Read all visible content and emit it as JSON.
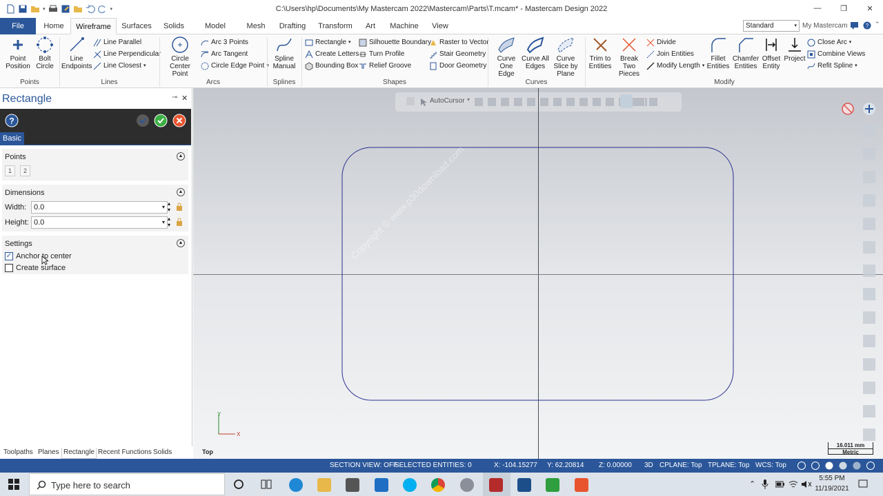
{
  "window": {
    "title": "C:\\Users\\hp\\Documents\\My Mastercam 2022\\Mastercam\\Parts\\T.mcam* - Mastercam Design 2022",
    "controls": [
      "minimize-icon",
      "restore-icon",
      "close-icon"
    ]
  },
  "ribbon": {
    "tabs": [
      "File",
      "Home",
      "Wireframe",
      "Surfaces",
      "Solids",
      "Model Prep",
      "Mesh",
      "Drafting",
      "Transform",
      "Art",
      "Machine",
      "View"
    ],
    "active_tab": "Wireframe",
    "config_select": "Standard",
    "my_mastercam": "My Mastercam",
    "groups": {
      "points": {
        "label": "Points",
        "point_position": "Point Position",
        "bolt_circle": "Bolt Circle"
      },
      "lines": {
        "label": "Lines",
        "line_endpoints": "Line Endpoints",
        "line_parallel": "Line Parallel",
        "line_perpendicular": "Line Perpendicular",
        "line_closest": "Line Closest"
      },
      "arcs": {
        "label": "Arcs",
        "circle_center_point": "Circle Center Point",
        "arc_3_points": "Arc 3 Points",
        "arc_tangent": "Arc Tangent",
        "circle_edge_point": "Circle Edge Point"
      },
      "splines": {
        "label": "Splines",
        "spline_manual": "Spline Manual"
      },
      "shapes": {
        "label": "Shapes",
        "rectangle": "Rectangle",
        "create_letters": "Create Letters",
        "bounding_box": "Bounding Box",
        "silhouette_boundary": "Silhouette Boundary",
        "turn_profile": "Turn Profile",
        "relief_groove": "Relief Groove",
        "raster_to_vector": "Raster to Vector",
        "stair_geometry": "Stair Geometry",
        "door_geometry": "Door Geometry"
      },
      "curves": {
        "label": "Curves",
        "curve_one_edge": "Curve One Edge",
        "curve_all_edges": "Curve All Edges",
        "curve_slice_by_plane": "Curve Slice by Plane"
      },
      "modify": {
        "label": "Modify",
        "trim_to_entities": "Trim to Entities",
        "break_two_pieces": "Break Two Pieces",
        "divide": "Divide",
        "join_entities": "Join Entities",
        "modify_length": "Modify Length",
        "fillet_entities": "Fillet Entities",
        "chamfer_entities": "Chamfer Entities",
        "offset_entity": "Offset Entity",
        "project": "Project",
        "close_arc": "Close Arc",
        "combine_views": "Combine Views",
        "refit_spline": "Refit Spline"
      }
    }
  },
  "panel": {
    "title": "Rectangle",
    "tab": "Basic",
    "points": {
      "title": "Points",
      "buttons": [
        "1",
        "2"
      ]
    },
    "dimensions": {
      "title": "Dimensions",
      "width_label": "Width:",
      "width_value": "0.0",
      "height_label": "Height:",
      "height_value": "0.0"
    },
    "settings": {
      "title": "Settings",
      "anchor_to_center": "Anchor to center",
      "anchor_checked": true,
      "create_surface": "Create surface",
      "surface_checked": false
    },
    "bottom_tabs": [
      "Toolpaths",
      "Planes",
      "Rectangle",
      "Recent Functions",
      "Solids"
    ],
    "active_bottom_tab": "Rectangle"
  },
  "viewport": {
    "autocursor": "AutoCursor",
    "view_label": "Top",
    "axis_x": "X",
    "axis_y": "Y",
    "scale_value": "16.011 mm",
    "scale_unit": "Metric",
    "watermark": "Copyright © www.p30download.com"
  },
  "statusbar": {
    "section_view": "SECTION VIEW: OFF",
    "selected": "SELECTED ENTITIES: 0",
    "x": "X:   -104.15277",
    "y": "Y:   62.20814",
    "z": "Z:   0.00000",
    "mode": "3D",
    "cplane": "CPLANE: Top",
    "tplane": "TPLANE: Top",
    "wcs": "WCS: Top"
  },
  "taskbar": {
    "search_placeholder": "Type here to search",
    "time": "5:55 PM",
    "date": "11/19/2021"
  },
  "colors": {
    "brand_blue": "#2b579a",
    "geometry": "#2a2f8f",
    "ok_green": "#3cb043",
    "cancel_orange": "#e8542e"
  }
}
